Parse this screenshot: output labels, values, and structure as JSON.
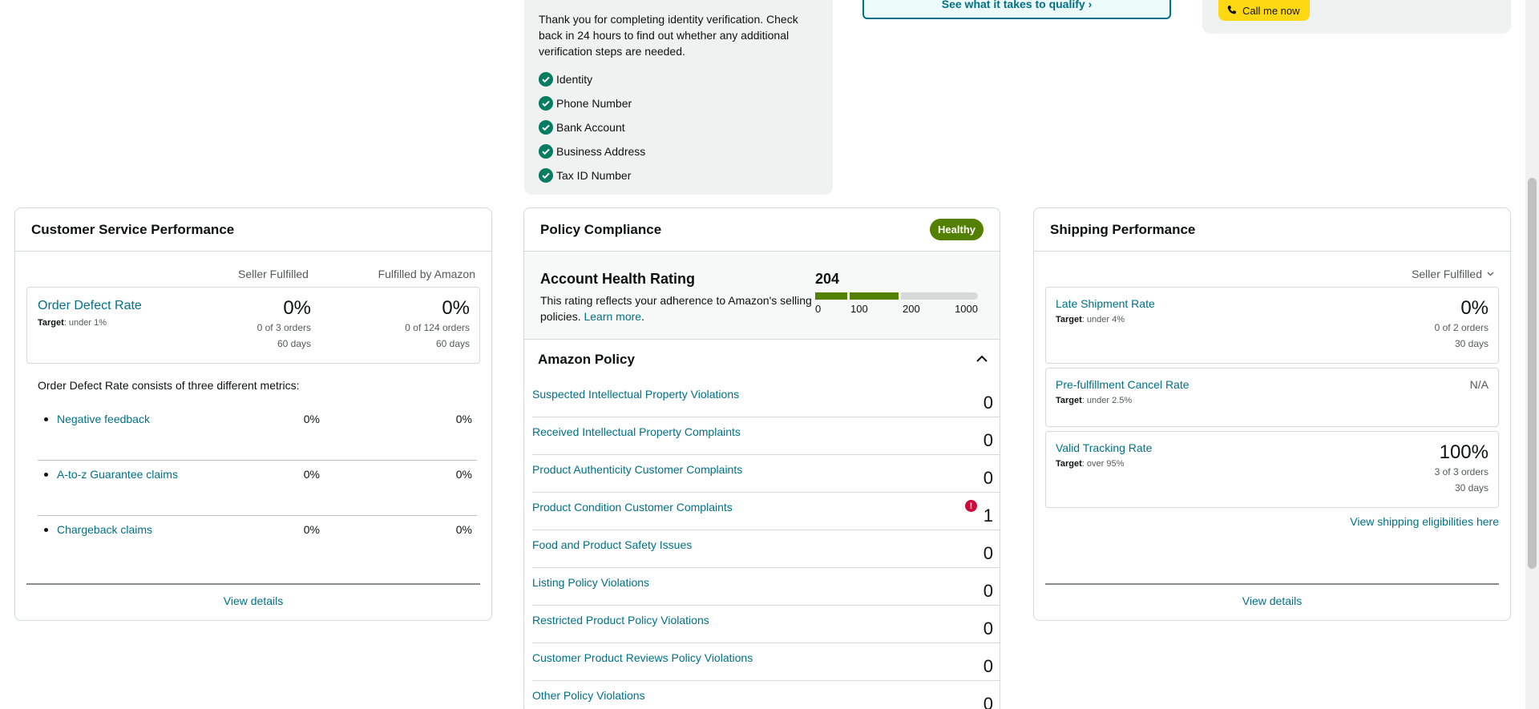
{
  "verification": {
    "message": "Thank you for completing identity verification. Check back in 24 hours to find out whether any additional verification steps are needed.",
    "items": [
      "Identity",
      "Phone Number",
      "Bank Account",
      "Business Address",
      "Tax ID Number"
    ]
  },
  "qualify": {
    "label": "See what it takes to qualify"
  },
  "call": {
    "label": "Call me now"
  },
  "customer_service": {
    "title": "Customer Service Performance",
    "col1": "Seller Fulfilled",
    "col2": "Fulfilled by Amazon",
    "odr": {
      "name": "Order Defect Rate",
      "target_label": "Target",
      "target_value": ": under 1%",
      "sf_value": "0%",
      "sf_orders": "0 of 3 orders",
      "sf_days": "60 days",
      "fba_value": "0%",
      "fba_orders": "0 of 124 orders",
      "fba_days": "60 days"
    },
    "consists": "Order Defect Rate consists of three different metrics:",
    "metrics": [
      {
        "name": "Negative feedback",
        "sf": "0%",
        "fba": "0%"
      },
      {
        "name": "A-to-z Guarantee claims",
        "sf": "0%",
        "fba": "0%"
      },
      {
        "name": "Chargeback claims",
        "sf": "0%",
        "fba": "0%"
      }
    ],
    "view_details": "View details"
  },
  "policy": {
    "title": "Policy Compliance",
    "status": "Healthy",
    "ahr_title": "Account Health Rating",
    "ahr_desc": "This rating reflects your adherence to Amazon's selling policies.",
    "learn_more": "Learn more",
    "score": "204",
    "ticks": [
      "0",
      "100",
      "200",
      "1000"
    ],
    "amazon_policy": "Amazon Policy",
    "rows": [
      {
        "name": "Suspected Intellectual Property Violations",
        "value": "0"
      },
      {
        "name": "Received Intellectual Property Complaints",
        "value": "0"
      },
      {
        "name": "Product Authenticity Customer Complaints",
        "value": "0"
      },
      {
        "name": "Product Condition Customer Complaints",
        "value": "1",
        "alert": "!"
      },
      {
        "name": "Food and Product Safety Issues",
        "value": "0"
      },
      {
        "name": "Listing Policy Violations",
        "value": "0"
      },
      {
        "name": "Restricted Product Policy Violations",
        "value": "0"
      },
      {
        "name": "Customer Product Reviews Policy Violations",
        "value": "0"
      },
      {
        "name": "Other Policy Violations",
        "value": "0"
      }
    ]
  },
  "shipping": {
    "title": "Shipping Performance",
    "filter": "Seller Fulfilled",
    "metrics": [
      {
        "name": "Late Shipment Rate",
        "target_label": "Target",
        "target_value": ": under 4%",
        "value": "0%",
        "orders": "0 of 2 orders",
        "days": "30 days"
      },
      {
        "name": "Pre-fulfillment Cancel Rate",
        "target_label": "Target",
        "target_value": ": under 2.5%",
        "value": "N/A"
      },
      {
        "name": "Valid Tracking Rate",
        "target_label": "Target",
        "target_value": ": over 95%",
        "value": "100%",
        "orders": "3 of 3 orders",
        "days": "30 days"
      }
    ],
    "eligibilities": "View shipping eligibilities here",
    "view_details": "View details"
  },
  "colors": {
    "accent": "#007185",
    "healthy": "#538000",
    "check": "#067d62",
    "alert": "#cc0c39",
    "call": "#ffd814"
  }
}
